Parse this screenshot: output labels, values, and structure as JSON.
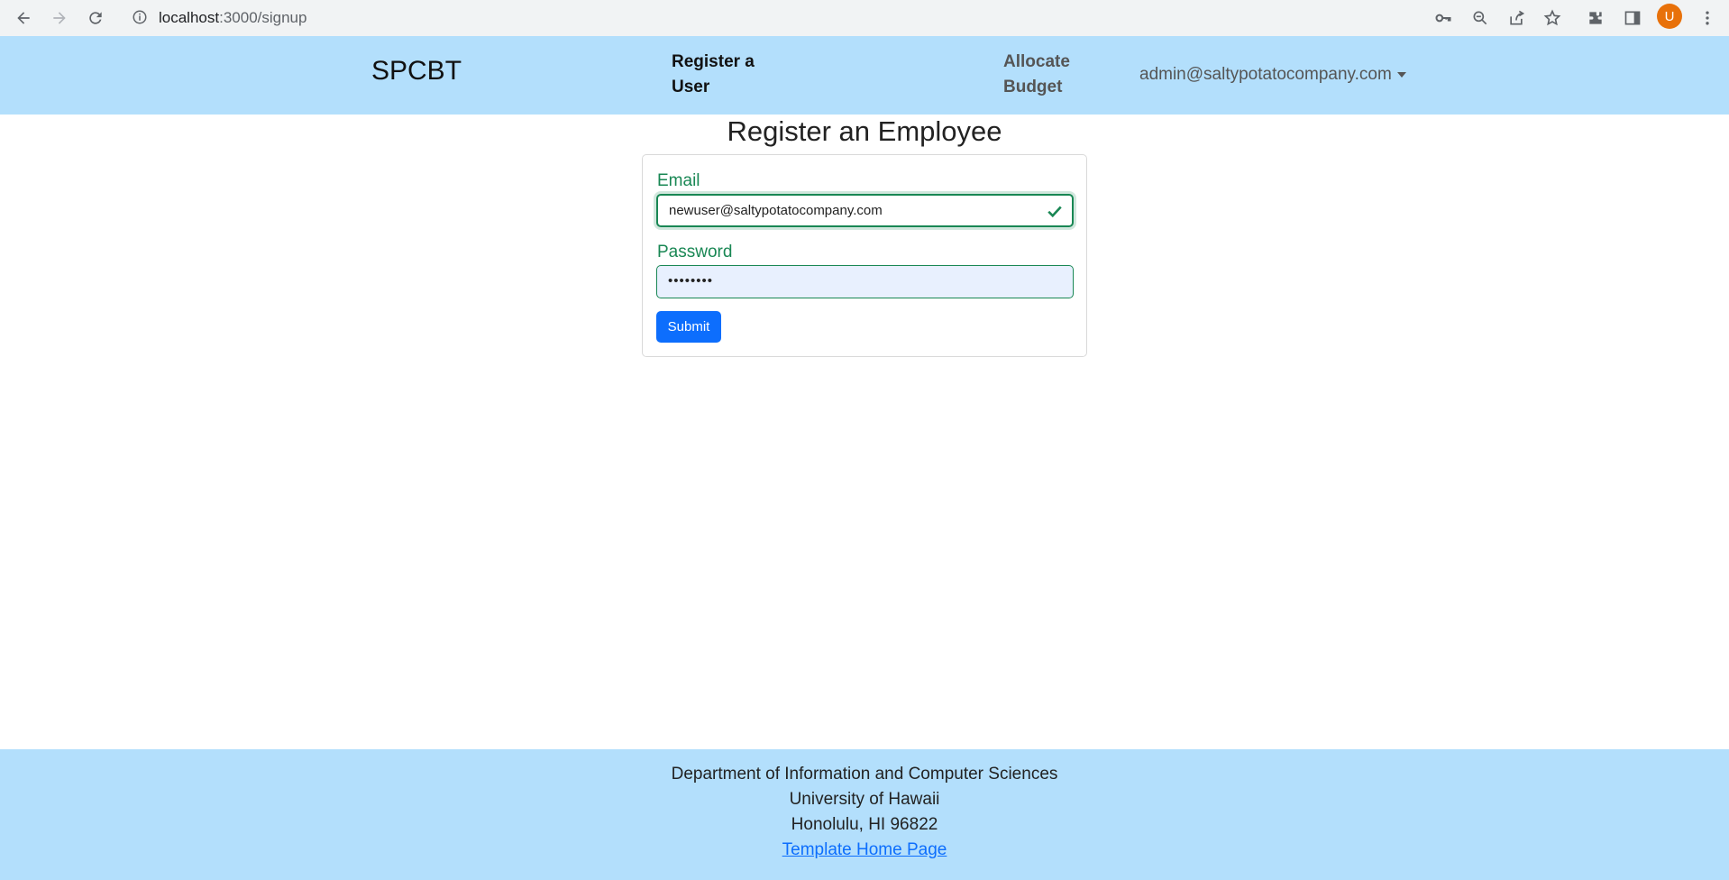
{
  "browser": {
    "url_host": "localhost",
    "url_path": ":3000/signup",
    "avatar_letter": "U"
  },
  "navbar": {
    "brand": "SPCBT",
    "register_line1": "Register a",
    "register_line2": "User",
    "allocate_line1": "Allocate",
    "allocate_line2": "Budget",
    "user_email": "admin@saltypotatocompany.com"
  },
  "main": {
    "title": "Register an Employee",
    "email_label": "Email",
    "email_value": "newuser@saltypotatocompany.com",
    "password_label": "Password",
    "password_value": "••••••••",
    "submit_label": "Submit"
  },
  "footer": {
    "line1": "Department of Information and Computer Sciences",
    "line2": "University of Hawaii",
    "line3": "Honolulu, HI 96822",
    "link": "Template Home Page"
  },
  "colors": {
    "navbar_bg": "#b3dffc",
    "valid_green": "#198754",
    "primary_blue": "#0d6efd"
  }
}
